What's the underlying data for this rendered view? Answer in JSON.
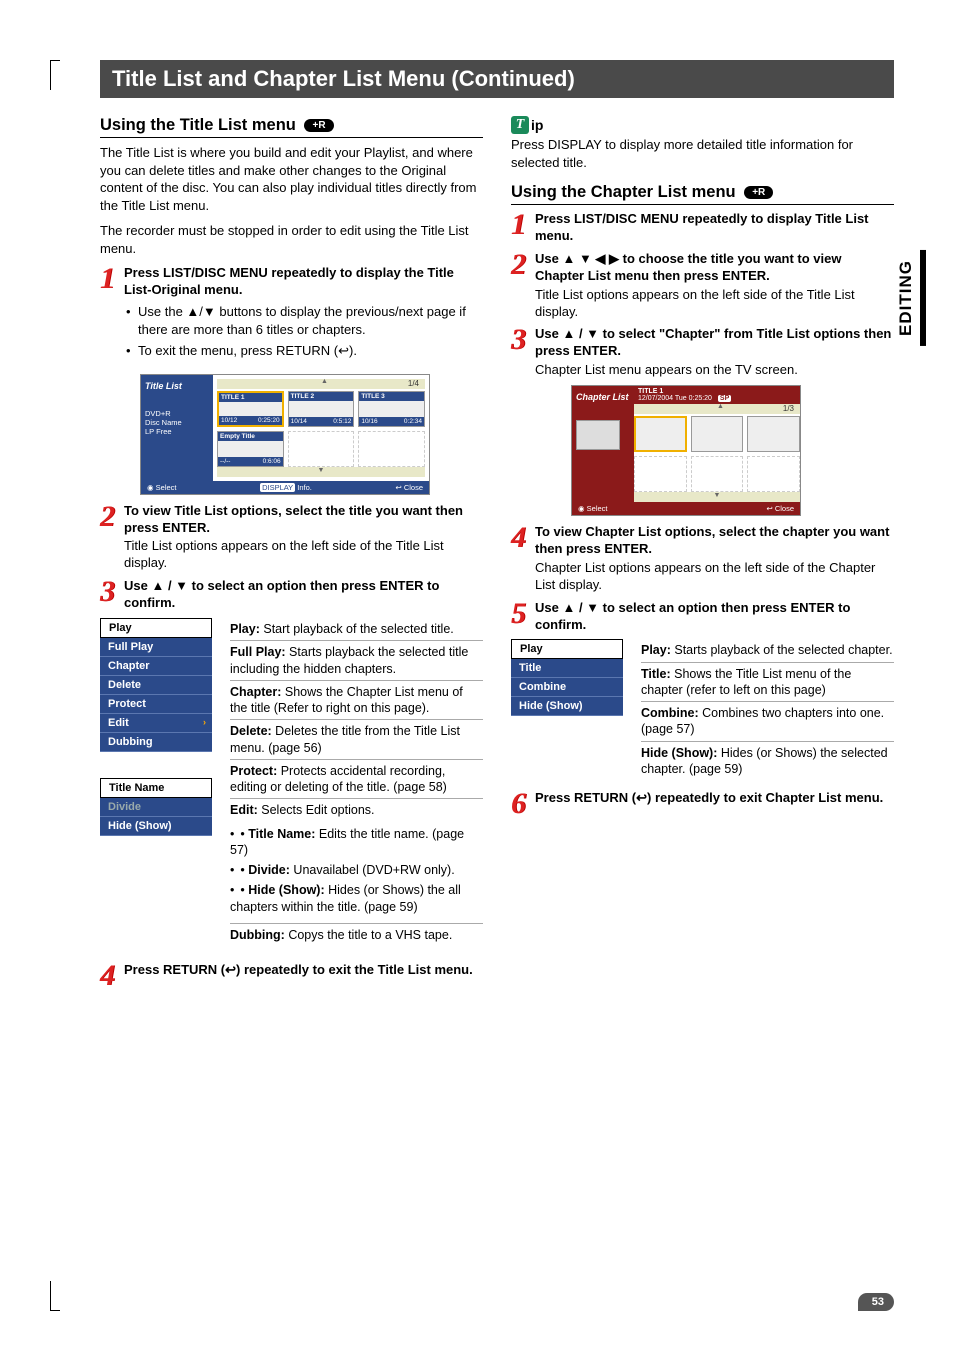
{
  "banner": "Title List and Chapter List Menu (Continued)",
  "sidetab": "EDITING",
  "pagenum": "53",
  "badge_r": "+R",
  "left": {
    "heading": "Using the Title List menu",
    "intro1": "The Title List is where you build and edit your Playlist, and where you can delete titles and make other changes to the Original content of the disc. You can also play individual titles directly from the Title List menu.",
    "intro2": "The recorder must be stopped in order to edit using the Title List menu.",
    "s1_lead": "Press LIST/DISC MENU repeatedly to display the Title List-Original menu.",
    "s1_b1": "Use the ▲/▼ buttons to display the previous/next page if there are more than 6 titles or chapters.",
    "s1_b2": "To exit the menu, press RETURN (↩).",
    "s2_lead": "To view Title List options, select the title you want then press ENTER.",
    "s2_p": "Title List options appears on the left side of the Title List display.",
    "s3_lead": "Use ▲ / ▼ to select an option then press ENTER to confirm.",
    "s4_lead": "Press RETURN (↩) repeatedly to exit the Title List menu.",
    "menu1": [
      "Play",
      "Full Play",
      "Chapter",
      "Delete",
      "Protect",
      "Edit",
      "Dubbing"
    ],
    "menu2": [
      "Title Name",
      "Divide",
      "Hide (Show)"
    ],
    "desc": {
      "play": {
        "k": "Play:",
        "t": " Start playback of the selected title."
      },
      "full": {
        "k": "Full Play:",
        "t": " Starts playback the selected title including the hidden chapters."
      },
      "chap": {
        "k": "Chapter:",
        "t": " Shows the Chapter List menu of the title (Refer to right on this page)."
      },
      "del": {
        "k": "Delete:",
        "t": " Deletes the title from the Title List menu. (page 56)"
      },
      "prot": {
        "k": "Protect:",
        "t": " Protects accidental recording, editing or deleting of the title. (page 58)"
      },
      "edit_h": "Edit:",
      "edit_t": " Selects Edit options.",
      "edit_tn": {
        "k": "Title Name:",
        "t": " Edits the title name. (page 57)"
      },
      "edit_dv": {
        "k": "Divide:",
        "t": " Unavailabel (DVD+RW only)."
      },
      "edit_hs": {
        "k": "Hide (Show):",
        "t": " Hides (or Shows) the all chapters within the title. (page 59)"
      },
      "dub": {
        "k": "Dubbing:",
        "t": " Copys the title to a VHS tape."
      }
    },
    "tv": {
      "label": "Title List",
      "sub1": "DVD+R",
      "sub2": "Disc Name",
      "sub3": "LP Free",
      "page": "1/4",
      "cells": [
        {
          "t": "TITLE 1",
          "d": "10/12",
          "r": "0:25:20",
          "sel": true
        },
        {
          "t": "TITLE 2",
          "d": "10/14",
          "r": "0:5:12"
        },
        {
          "t": "TITLE 3",
          "d": "10/16",
          "r": "0:2:34"
        },
        {
          "t": "Empty Title",
          "d": "--/--",
          "r": "0:6:06"
        },
        {
          "empty": true
        },
        {
          "empty": true
        }
      ],
      "foot": {
        "select": "Select",
        "info": "Info.",
        "close": "Close",
        "display": "DISPLAY"
      }
    }
  },
  "right": {
    "tip_label": "ip",
    "tip_text": "Press DISPLAY to display more detailed title information for selected title.",
    "heading": "Using the Chapter List menu",
    "s1": "Press LIST/DISC MENU repeatedly to display Title List menu.",
    "s2_lead": "Use ▲ ▼ ◀ ▶ to choose the title you want to view Chapter List menu then press ENTER.",
    "s2_p": "Title List options appears on the left side of the Title List display.",
    "s3_lead": "Use ▲ / ▼ to select \"Chapter\" from Title List options then press ENTER.",
    "s3_p": "Chapter List menu appears on the TV screen.",
    "s4_lead": "To view Chapter List options, select the chapter you want then press ENTER.",
    "s4_p": "Chapter List options appears on the left side of the Chapter List display.",
    "s5_lead": "Use ▲ / ▼ to select an option then press ENTER to confirm.",
    "s6_lead": "Press RETURN (↩) repeatedly to exit Chapter List menu.",
    "menu": [
      "Play",
      "Title",
      "Combine",
      "Hide (Show)"
    ],
    "desc": {
      "play": {
        "k": "Play:",
        "t": " Starts playback of the selected chapter."
      },
      "title": {
        "k": "Title:",
        "t": " Shows the Title List menu of the chapter (refer to left on this page)"
      },
      "comb": {
        "k": "Combine:",
        "t": " Combines two chapters into one. (page 57)"
      },
      "hide": {
        "k": "Hide (Show):",
        "t": " Hides (or Shows) the selected chapter. (page 59)"
      }
    },
    "tv": {
      "label": "Chapter List",
      "titlebar1": "TITLE 1",
      "titlebar2": "12/07/2004  Tue   0:25:20",
      "sp": "SP",
      "page": "1/3",
      "foot": {
        "select": "Select",
        "close": "Close"
      }
    }
  }
}
